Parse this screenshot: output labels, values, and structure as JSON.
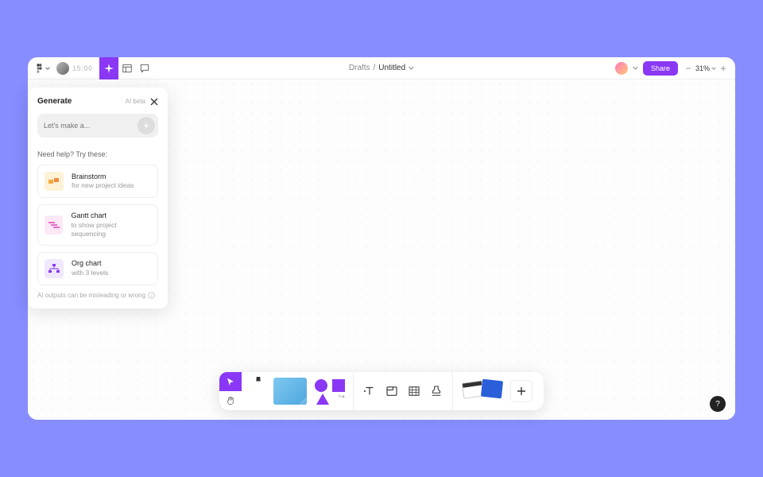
{
  "header": {
    "timer": "15:00",
    "breadcrumb_root": "Drafts",
    "breadcrumb_sep": "/",
    "doc_title": "Untitled",
    "share_label": "Share",
    "zoom_value": "31%"
  },
  "generate_panel": {
    "title": "Generate",
    "beta_label": "AI beta",
    "prompt_placeholder": "Let's make a...",
    "help_label": "Need help? Try these:",
    "suggestions": [
      {
        "title": "Brainstorm",
        "sub": "for new project ideas"
      },
      {
        "title": "Gantt chart",
        "sub": "to show project sequencing"
      },
      {
        "title": "Org chart",
        "sub": "with 3 levels"
      }
    ],
    "disclaimer": "AI outputs can be misleading or wrong"
  },
  "help_fab": "?"
}
